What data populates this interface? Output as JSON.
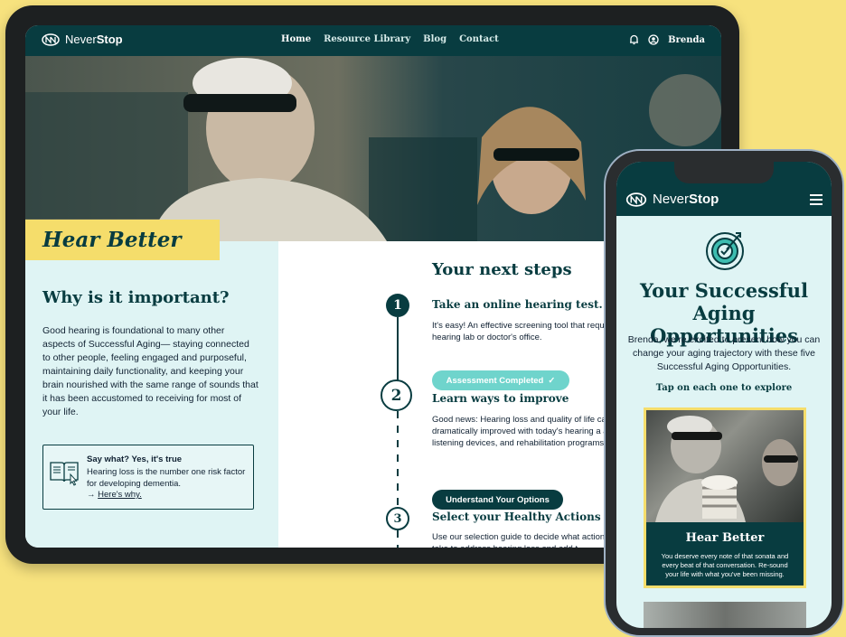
{
  "brand": {
    "name_a": "Never",
    "name_b": "Stop"
  },
  "tablet": {
    "nav": {
      "links": [
        "Home",
        "Resource Library",
        "Blog",
        "Contact"
      ],
      "active": "Home",
      "user": "Brenda"
    },
    "hero_title": "Hear Better",
    "why": {
      "heading": "Why is it important?",
      "body": "Good hearing is foundational to many other aspects of Successful Aging— staying connected to other people, feeling engaged and purposeful, maintaining daily functionality, and keeping your brain nourished with the same range of sounds that it has been accustomed to receiving for most of your life."
    },
    "note": {
      "title": "Say what? Yes, it's true",
      "body": "Hearing loss is the number one risk factor for developing dementia.",
      "link_prefix": "→ ",
      "link": "Here's why."
    },
    "steps": {
      "heading": "Your next steps",
      "items": [
        {
          "num": "1",
          "title": "Take an online hearing test.",
          "body": "It's easy! An effective screening tool that requ trip to a hearing lab or doctor's office.",
          "button": "Assessment Completed"
        },
        {
          "num": "2",
          "title": "Learn ways to improve",
          "body": "Good news: Hearing loss and quality of life car dramatically improved with today's hearing a assistive listening devices, and rehabilitation programs.",
          "button": "Understand Your Options"
        },
        {
          "num": "3",
          "title": "Select your Healthy Actions",
          "body": "Use our  selection guide to decide what action want to take to address hearing loss and add t"
        }
      ]
    }
  },
  "phone": {
    "title": "Your Successful Aging Opportunities",
    "subtitle": "Brenda, we’re excited to present how you can change your aging trajectory with these five Successful Aging Opportunities.",
    "tap": "Tap on each one to explore",
    "card": {
      "title": "Hear Better",
      "body": "You deserve every note of that sonata and every beat of that conversation. Re-sound your life with what you've been missing."
    }
  },
  "colors": {
    "primary": "#083c40",
    "accent": "#f5dd6b",
    "mint": "#6fd4cc",
    "background": "#f7e27e"
  }
}
